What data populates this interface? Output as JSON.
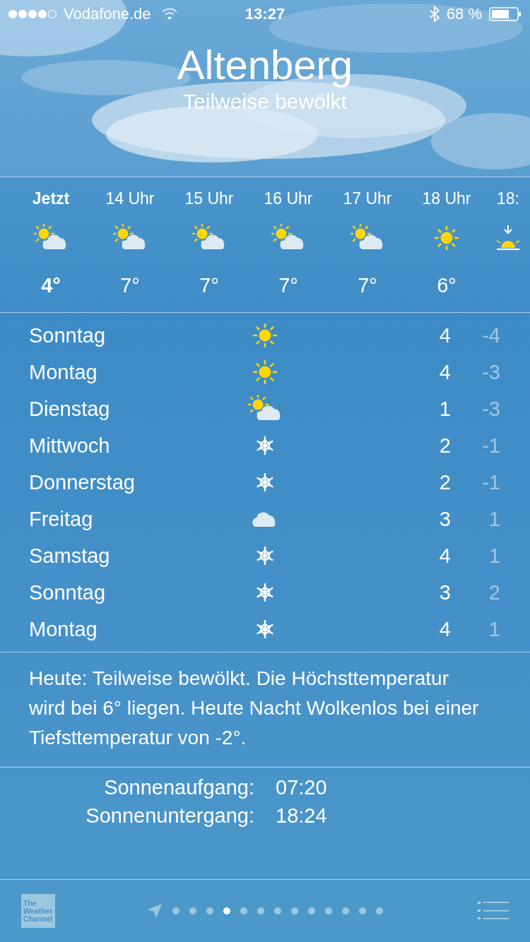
{
  "status_bar": {
    "carrier": "Vodafone.de",
    "time": "13:27",
    "battery": "68 %"
  },
  "header": {
    "city": "Altenberg",
    "condition": "Teilweise bewölkt"
  },
  "hourly": [
    {
      "time": "Jetzt",
      "now": true,
      "kind": "partly",
      "temp": "4°"
    },
    {
      "time": "14 Uhr",
      "now": false,
      "kind": "partly",
      "temp": "7°"
    },
    {
      "time": "15 Uhr",
      "now": false,
      "kind": "partly",
      "temp": "7°"
    },
    {
      "time": "16 Uhr",
      "now": false,
      "kind": "partly",
      "temp": "7°"
    },
    {
      "time": "17 Uhr",
      "now": false,
      "kind": "partly",
      "temp": "7°"
    },
    {
      "time": "18 Uhr",
      "now": false,
      "kind": "sun",
      "temp": "6°"
    },
    {
      "time": "18:",
      "now": false,
      "kind": "sunset"
    }
  ],
  "daily": [
    {
      "day": "Sonntag",
      "kind": "sun",
      "high": "4",
      "low": "-4"
    },
    {
      "day": "Montag",
      "kind": "sun",
      "high": "4",
      "low": "-3"
    },
    {
      "day": "Dienstag",
      "kind": "partly",
      "high": "1",
      "low": "-3"
    },
    {
      "day": "Mittwoch",
      "kind": "snow",
      "high": "2",
      "low": "-1"
    },
    {
      "day": "Donnerstag",
      "kind": "snow",
      "high": "2",
      "low": "-1"
    },
    {
      "day": "Freitag",
      "kind": "cloud",
      "high": "3",
      "low": "1"
    },
    {
      "day": "Samstag",
      "kind": "snow",
      "high": "4",
      "low": "1"
    },
    {
      "day": "Sonntag",
      "kind": "snow",
      "high": "3",
      "low": "2"
    },
    {
      "day": "Montag",
      "kind": "snow",
      "high": "4",
      "low": "1"
    }
  ],
  "summary": "Heute: Teilweise bewölkt. Die Höchsttemperatur wird bei 6° liegen. Heute Nacht Wolkenlos bei einer Tiefsttemperatur von -2°.",
  "details": [
    {
      "label": "Sonnenaufgang:",
      "value": "07:20"
    },
    {
      "label": "Sonnenuntergang:",
      "value": "18:24"
    }
  ],
  "toolbar": {
    "logo": [
      "The",
      "Weather",
      "Channel"
    ],
    "pages": [
      {
        "selected": false
      },
      {
        "selected": false
      },
      {
        "selected": false
      },
      {
        "selected": true
      },
      {
        "selected": false
      },
      {
        "selected": false
      },
      {
        "selected": false
      },
      {
        "selected": false
      },
      {
        "selected": false
      },
      {
        "selected": false
      },
      {
        "selected": false
      },
      {
        "selected": false
      },
      {
        "selected": false
      }
    ]
  }
}
